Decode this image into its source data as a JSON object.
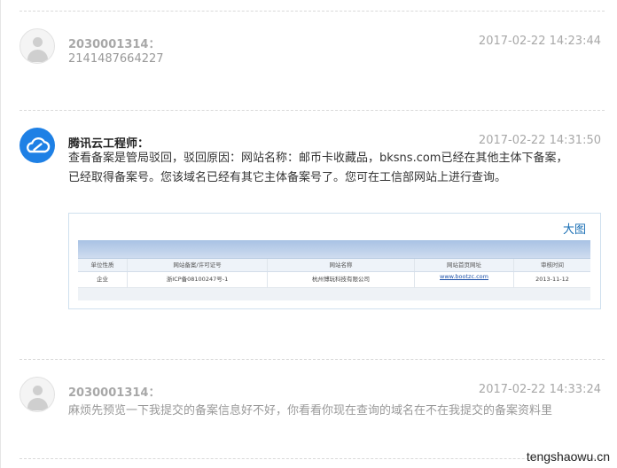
{
  "comments": [
    {
      "author": "2030001314：",
      "time": "2017-02-22 14:23:44",
      "text": "2141487664227",
      "avatar_icon": "default-user-icon"
    },
    {
      "author": "腾讯云工程师：",
      "time": "2017-02-22 14:31:50",
      "text_line1": "查看备案是管局驳回，驳回原因：网站名称：邮币卡收藏品，bksns.com已经在其他主体下备案，",
      "text_line2": "已经取得备案号。您该域名已经有其它主体备案号了。您可在工信部网站上进行查询。",
      "avatar_icon": "tencent-cloud-icon",
      "image": {
        "link_label": "大图",
        "headers": [
          "单位性质",
          "网站备案/许可证号",
          "网站名称",
          "网站首页网址",
          "审核时间"
        ],
        "row": [
          "企业",
          "浙ICP备08100247号-1",
          "杭州博玩科技有限公司",
          "www.bootzc.com",
          "2013-11-12"
        ]
      }
    },
    {
      "author": "2030001314：",
      "time": "2017-02-22 14:33:24",
      "text": "麻烦先预览一下我提交的备案信息好不好，你看看你现在查询的域名在不在我提交的备案资料里",
      "avatar_icon": "default-user-icon"
    }
  ],
  "watermark": "tengshaowu.cn",
  "colors": {
    "accent": "#1e80e5",
    "muted": "#a8a8a8",
    "link": "#1a6fb5"
  }
}
